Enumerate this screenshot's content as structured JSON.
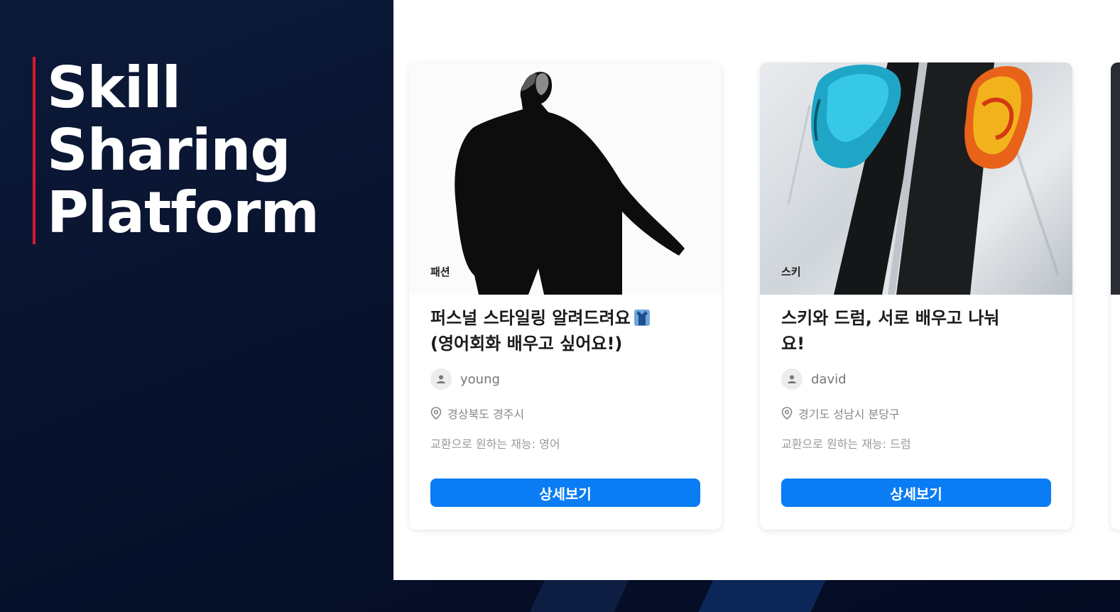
{
  "headline": {
    "lines": [
      "Skill",
      "Sharing",
      "Platform"
    ],
    "accent_color": "#d7192a"
  },
  "cards": [
    {
      "category": "패션",
      "title": "퍼스널 스타일링 알려드려요",
      "title_line2": "(영어회화 배우고 싶어요!)",
      "title_icon": "clothing-icon",
      "author": "young",
      "location": "경상북도 경주시",
      "wanted_skill": "교환으로 원하는 재능: 영어",
      "button_label": "상세보기"
    },
    {
      "category": "스키",
      "title": "스키와 드럼, 서로 배우고 나눠",
      "title_line2": "요!",
      "author": "david",
      "location": "경기도 성남시 분당구",
      "wanted_skill": "교환으로 원하는 재능: 드럼",
      "button_label": "상세보기"
    }
  ],
  "colors": {
    "button": "#0a7cf4",
    "background": "#08132e"
  }
}
